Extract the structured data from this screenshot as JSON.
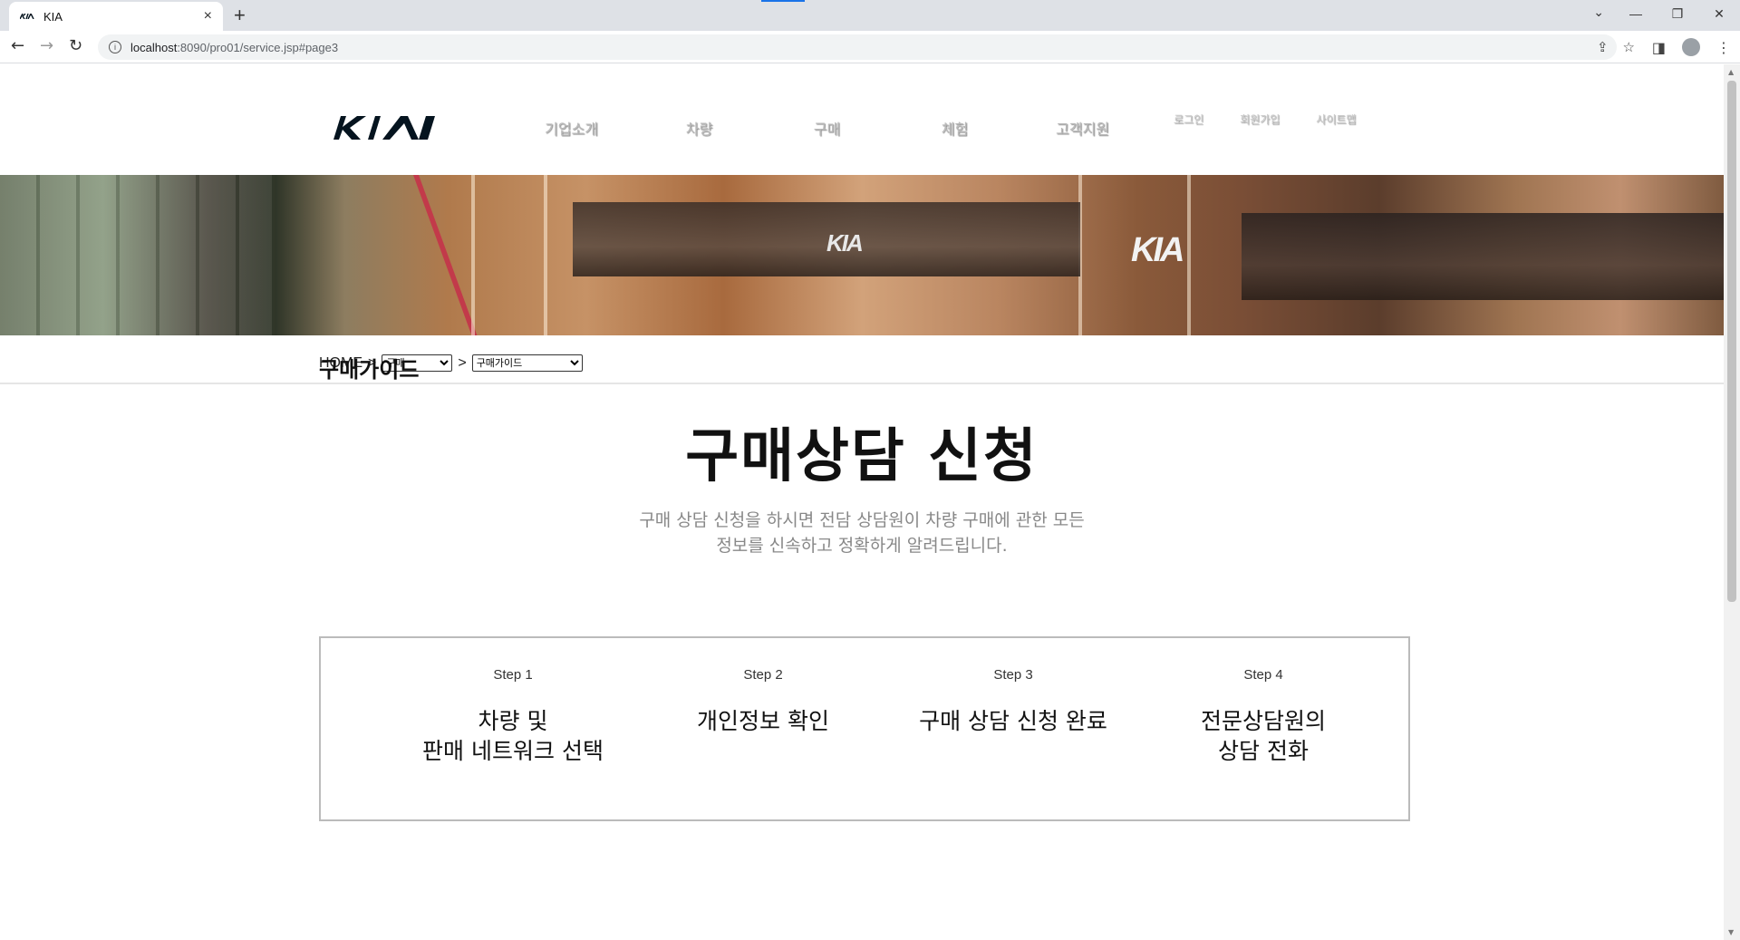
{
  "browser": {
    "tab_title": "KIA",
    "tab_close": "×",
    "new_tab": "+",
    "url_host": "localhost",
    "url_rest": ":8090/pro01/service.jsp#page3",
    "controls": {
      "dropdown": "⌄",
      "minimize": "—",
      "restore": "❐",
      "close": "✕"
    },
    "nav": {
      "back": "←",
      "forward": "→",
      "reload": "↻"
    }
  },
  "header": {
    "logo_text": "KIA",
    "gnb": [
      "기업소개",
      "차량",
      "구매",
      "체험",
      "고객지원"
    ],
    "util": [
      "로그인",
      "회원가입",
      "사이트맵"
    ]
  },
  "banner": {
    "sign_small": "KIA",
    "sign_large": "KIA"
  },
  "breadcrumb": {
    "home": "HOME",
    "sep1": ">",
    "sep2": ">",
    "select1_value": "구매",
    "select2_value": "구매가이드"
  },
  "content": {
    "section_title": "구매가이드",
    "main_title": "구매상담 신청",
    "desc_line1": "구매 상담 신청을 하시면 전담 상담원이 차량 구매에 관한 모든",
    "desc_line2": "정보를 신속하고 정확하게 알려드립니다."
  },
  "steps": [
    {
      "label": "Step 1",
      "name": "차량 및\n판매 네트워크 선택"
    },
    {
      "label": "Step 2",
      "name": "개인정보 확인"
    },
    {
      "label": "Step 3",
      "name": "구매 상담 신청 완료"
    },
    {
      "label": "Step 4",
      "name": "전문상담원의\n상담 전화"
    }
  ],
  "colors": {
    "accent": "#05141f",
    "muted_text": "#888888",
    "border": "#bbbbbb"
  }
}
